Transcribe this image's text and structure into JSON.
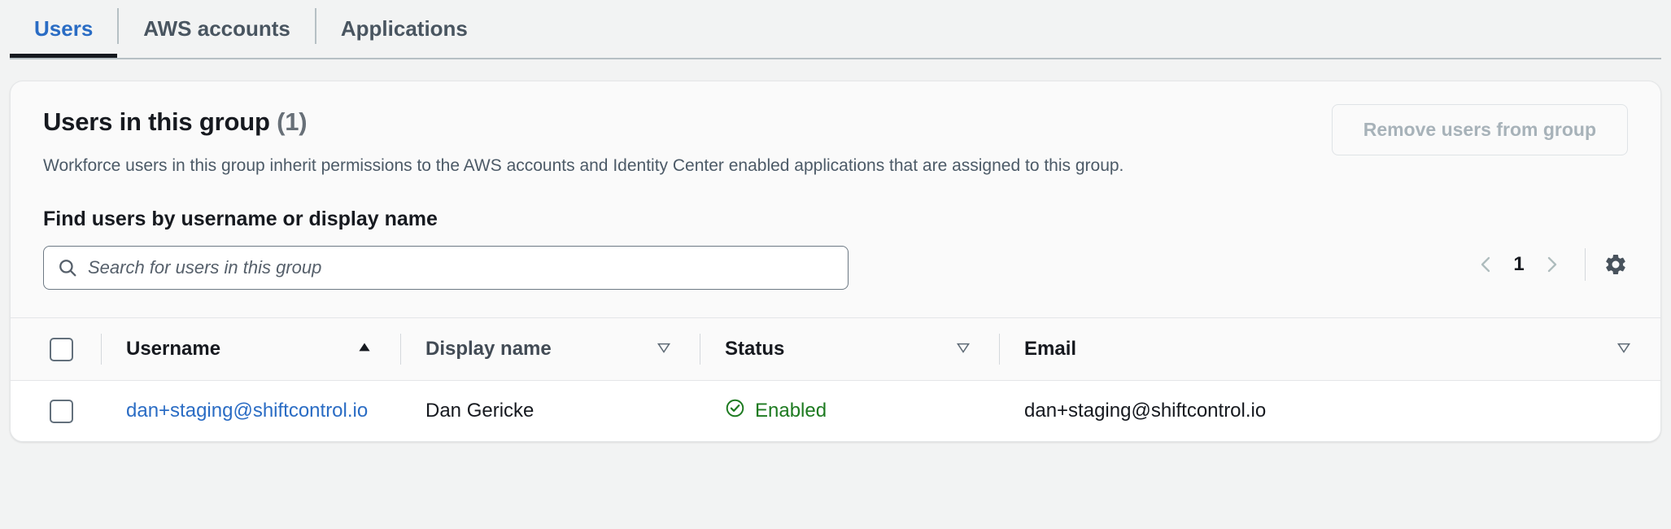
{
  "tabs": [
    {
      "label": "Users",
      "active": true
    },
    {
      "label": "AWS accounts",
      "active": false
    },
    {
      "label": "Applications",
      "active": false
    }
  ],
  "panel": {
    "title": "Users in this group",
    "count": "(1)",
    "description": "Workforce users in this group inherit permissions to the AWS accounts and Identity Center enabled applications that are assigned to this group.",
    "remove_button": "Remove users from group"
  },
  "search": {
    "label": "Find users by username or display name",
    "placeholder": "Search for users in this group",
    "value": "",
    "icon": "search-icon"
  },
  "pagination": {
    "previous_icon": "chevron-left-icon",
    "next_icon": "chevron-right-icon",
    "page": "1",
    "settings_icon": "gear-icon"
  },
  "table": {
    "columns": [
      {
        "label": "Username",
        "sort": "ascending",
        "sort_icon": "caret-up-filled-icon"
      },
      {
        "label": "Display name",
        "sort": "none",
        "sort_icon": "caret-down-outline-icon"
      },
      {
        "label": "Status",
        "sort": "none",
        "sort_icon": "caret-down-outline-icon"
      },
      {
        "label": "Email",
        "sort": "none",
        "sort_icon": "caret-down-outline-icon"
      }
    ],
    "rows": [
      {
        "username": "dan+staging@shiftcontrol.io",
        "display_name": "Dan Gericke",
        "status": "Enabled",
        "status_icon": "check-circle-icon",
        "email": "dan+staging@shiftcontrol.io"
      }
    ]
  },
  "colors": {
    "link": "#2a6cc4",
    "status_enabled": "#1d7a20",
    "page_background": "#f2f3f3",
    "active_tab_underline": "#16191f"
  }
}
